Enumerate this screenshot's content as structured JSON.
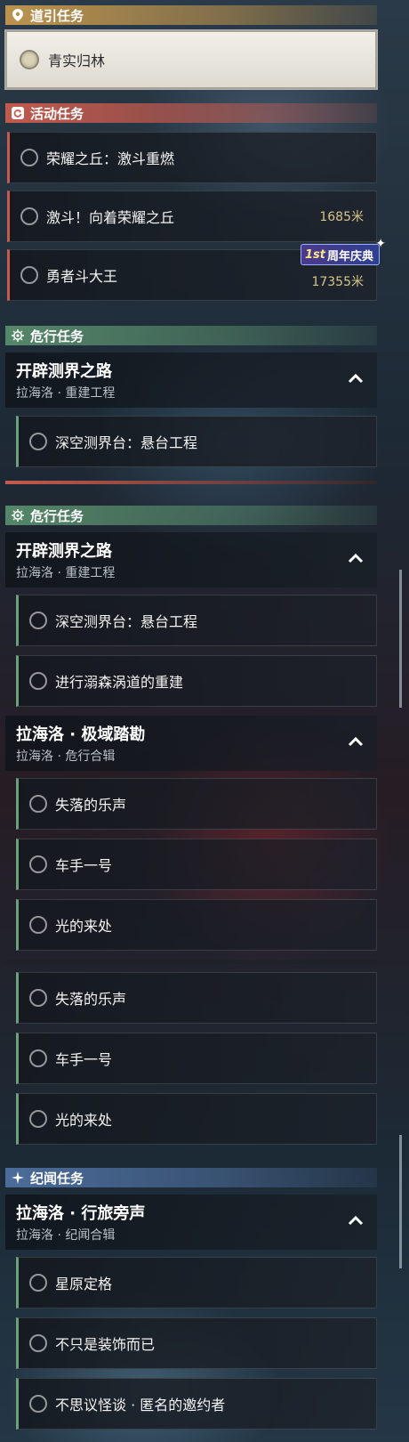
{
  "sections": {
    "guide": "道引任务",
    "event": "活动任务",
    "danger": "危行任务",
    "chronicle": "纪闻任务"
  },
  "tracked_task": "青实归林",
  "event_tasks": [
    {
      "name": "荣耀之丘：激斗重燃",
      "distance": ""
    },
    {
      "name": "激斗！向着荣耀之丘",
      "distance": "1685米"
    },
    {
      "name": "勇者斗大王",
      "distance": "17355米"
    }
  ],
  "anniversary_badge": {
    "num": "1st",
    "label": "周年庆典"
  },
  "danger_group_1": {
    "title": "开辟测界之路",
    "subtitle": "拉海洛 · 重建工程",
    "tasks": [
      "深空测界台：悬台工程"
    ]
  },
  "danger_group_2": {
    "title": "开辟测界之路",
    "subtitle": "拉海洛 · 重建工程",
    "tasks": [
      "深空测界台：悬台工程",
      "进行溺森涡道的重建"
    ]
  },
  "danger_group_3": {
    "title": "拉海洛 · 极域踏勘",
    "subtitle": "拉海洛 · 危行合辑",
    "tasks": [
      "失落的乐声",
      "车手一号",
      "光的来处"
    ]
  },
  "loose_tasks": [
    "失落的乐声",
    "车手一号",
    "光的来处"
  ],
  "chronicle_group": {
    "title": "拉海洛 · 行旅旁声",
    "subtitle": "拉海洛 · 纪闻合辑",
    "tasks": [
      "星原定格",
      "不只是装饰而已",
      "不思议怪谈 · 匿名的邀约者"
    ]
  },
  "colors": {
    "guide": "#c4984e",
    "event": "#ca5c4e",
    "danger": "#588c6c",
    "chronicle": "#4e70a0"
  }
}
